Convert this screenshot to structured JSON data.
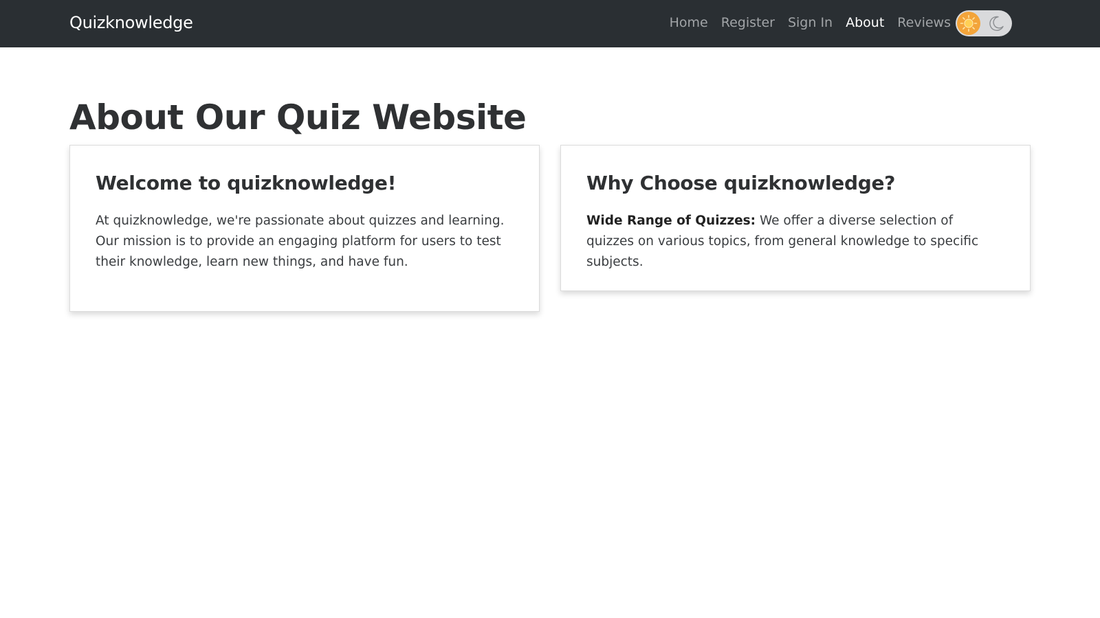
{
  "navbar": {
    "brand": "Quizknowledge",
    "links": [
      {
        "label": "Home",
        "active": false
      },
      {
        "label": "Register",
        "active": false
      },
      {
        "label": "Sign In",
        "active": false
      },
      {
        "label": "About",
        "active": true
      },
      {
        "label": "Reviews",
        "active": false
      }
    ],
    "theme_toggle": {
      "state": "light",
      "icons": [
        "sun-icon",
        "moon-icon"
      ],
      "accent": "#f3a43a"
    },
    "background": "#2a2f33"
  },
  "main": {
    "title": "About Our Quiz Website",
    "cards": [
      {
        "title": "Welcome to quizknowledge!",
        "text": "At quizknowledge, we're passionate about quizzes and learning. Our mission is to provide an engaging platform for users to test their knowledge, learn new things, and have fun."
      },
      {
        "title": "Why Choose quizknowledge?",
        "bold_lead": "Wide Range of Quizzes:",
        "text": "We offer a diverse selection of quizzes on various topics, from general knowledge to specific subjects."
      }
    ]
  }
}
